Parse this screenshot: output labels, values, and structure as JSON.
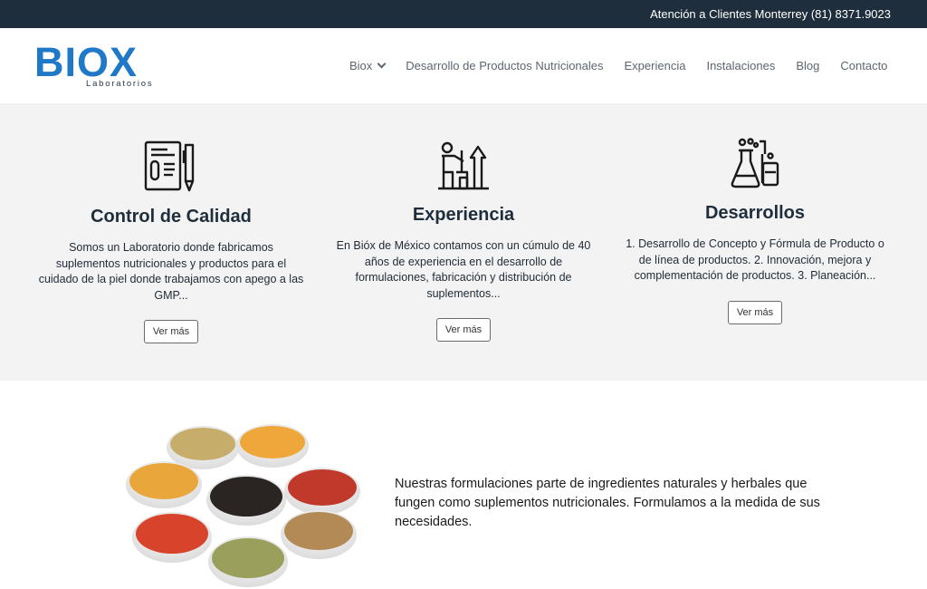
{
  "topbar": {
    "text": "Atención a Clientes Monterrey (81) 8371.9023"
  },
  "logo": {
    "word": "BIOX",
    "subtitle": "Laboratorios"
  },
  "nav": [
    {
      "label": "Biox",
      "has_dropdown": true
    },
    {
      "label": "Desarrollo de Productos Nutricionales"
    },
    {
      "label": "Experiencia"
    },
    {
      "label": "Instalaciones"
    },
    {
      "label": "Blog"
    },
    {
      "label": "Contacto"
    }
  ],
  "features": [
    {
      "icon": "quality-document-icon",
      "title": "Control de Calidad",
      "text": "Somos un Laboratorio donde fabricamos suplementos nutricionales y productos para el cuidado de la piel donde trabajamos con apego a las GMP...",
      "button": "Ver más"
    },
    {
      "icon": "growth-person-icon",
      "title": "Experiencia",
      "text": "En Bióx de México contamos con un cúmulo de 40 años de experiencia en el desarrollo de formulaciones, fabricación y distribución de suplementos...",
      "button": "Ver más"
    },
    {
      "icon": "lab-flask-icon",
      "title": "Desarrollos",
      "text": "1. Desarrollo de Concepto y Fórmula de Producto o de línea de productos. 2. Innovación, mejora y complementación de productos. 3. Planeación...",
      "button": "Ver más"
    }
  ],
  "lower": {
    "image": "spice-bowls-image",
    "text": "Nuestras formulaciones parte de ingredientes naturales y herbales que fungen como suplementos nutricionales. Formulamos a la medida de sus necesidades."
  },
  "colors": {
    "topbar": "#1f2e3c",
    "brand_blue": "#1f78c8",
    "features_bg": "#f3f3f3",
    "heading": "#1f2e3c"
  }
}
